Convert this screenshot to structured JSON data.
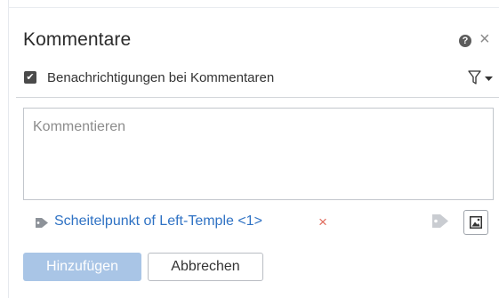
{
  "header": {
    "title": "Kommentare",
    "help_icon": "question-circle-icon",
    "help_glyph": "?",
    "close_icon": "close-icon",
    "close_glyph": "×"
  },
  "notifications": {
    "checked": true,
    "check_glyph": "✔",
    "label": "Benachrichtigungen bei Kommentaren",
    "filter_icon": "filter-icon",
    "caret_icon": "caret-down-icon"
  },
  "comment_input": {
    "placeholder": "Kommentieren",
    "value": ""
  },
  "mention": {
    "icon": "tag-icon",
    "label": "Scheitelpunkt of Left-Temple <1>",
    "remove_glyph": "×",
    "color": "#2f72c4",
    "remove_color": "#e06a5b"
  },
  "attachments": {
    "tag_icon": "tag-icon",
    "image_icon": "image-icon"
  },
  "actions": {
    "add_label": "Hinzufügen",
    "cancel_label": "Abbrechen",
    "add_color": "#a9c5e6"
  }
}
